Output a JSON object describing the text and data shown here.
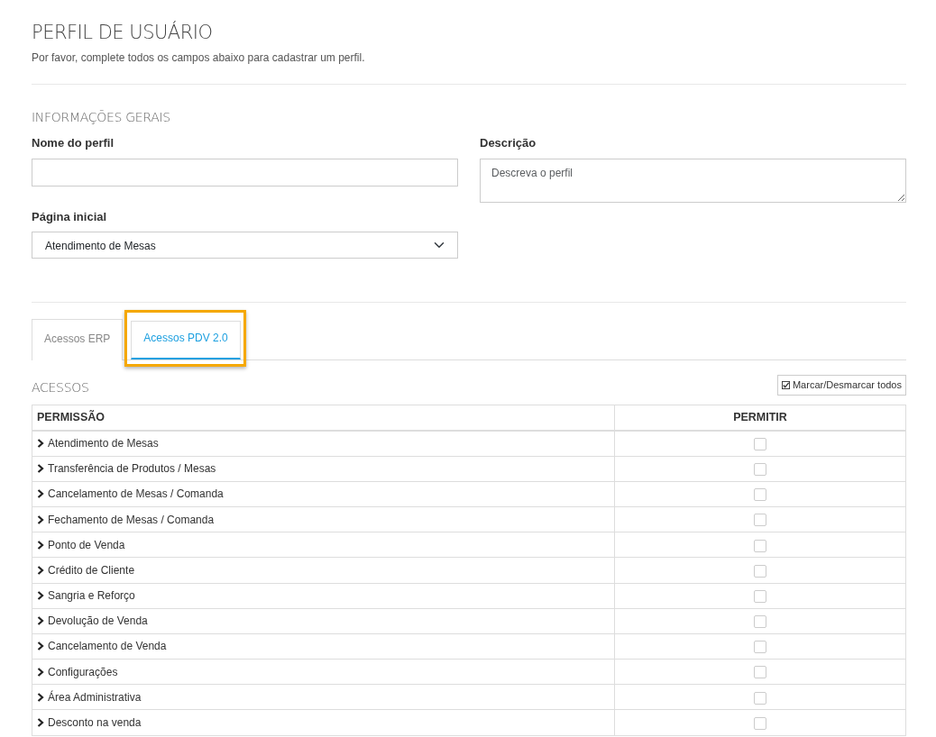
{
  "header": {
    "title": "PERFIL DE USUÁRIO",
    "subtitle": "Por favor, complete todos os campos abaixo para cadastrar um perfil."
  },
  "general": {
    "title": "INFORMAÇÕES GERAIS",
    "name_field": {
      "label": "Nome do perfil"
    },
    "description_field": {
      "label": "Descrição",
      "placeholder": "Descreva o perfil"
    },
    "start_page_field": {
      "label": "Página inicial",
      "value": "Atendimento de Mesas"
    }
  },
  "tabs": [
    {
      "label": "Acessos ERP",
      "selected": false,
      "highlighted": false
    },
    {
      "label": "Acessos PDV 2.0",
      "selected": true,
      "highlighted": true
    }
  ],
  "access": {
    "title": "ACESSOS",
    "toggle_all_button": "Marcar/Desmarcar todos",
    "columns": [
      "PERMISSÃO",
      "PERMITIR"
    ],
    "rows": [
      {
        "name": "Atendimento de Mesas",
        "checked": false
      },
      {
        "name": "Transferência de Produtos / Mesas",
        "checked": false
      },
      {
        "name": "Cancelamento de Mesas / Comanda",
        "checked": false
      },
      {
        "name": "Fechamento de Mesas / Comanda",
        "checked": false
      },
      {
        "name": "Ponto de Venda",
        "checked": false
      },
      {
        "name": "Crédito de Cliente",
        "checked": false
      },
      {
        "name": "Sangria e Reforço",
        "checked": false
      },
      {
        "name": "Devolução de Venda",
        "checked": false
      },
      {
        "name": "Cancelamento de Venda",
        "checked": false
      },
      {
        "name": "Configurações",
        "checked": false
      },
      {
        "name": "Área Administrativa",
        "checked": false
      },
      {
        "name": "Desconto na venda",
        "checked": false
      }
    ]
  }
}
